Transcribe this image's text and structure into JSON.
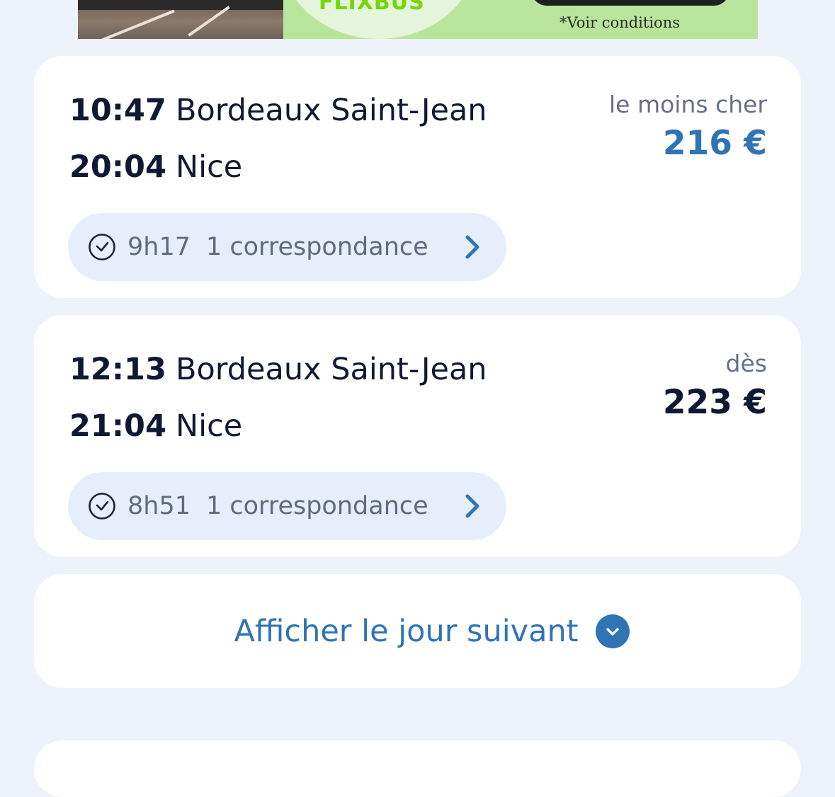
{
  "banner": {
    "brand": "FLIXBUS",
    "conditions": "*Voir conditions",
    "brand_color": "#73d700",
    "background_color": "#b8e59b"
  },
  "trips": [
    {
      "departure_time": "10:47",
      "departure_station": "Bordeaux Saint-Jean",
      "arrival_time": "20:04",
      "arrival_station": "Nice",
      "price_label": "le moins cher",
      "price": "216 €",
      "price_highlight": true,
      "duration": "9h17",
      "connections": "1 correspondance",
      "clock_icon": "clock-icon",
      "details_icon": "chevron-right-icon"
    },
    {
      "departure_time": "12:13",
      "departure_station": "Bordeaux Saint-Jean",
      "arrival_time": "21:04",
      "arrival_station": "Nice",
      "price_label": "dès",
      "price": "223 €",
      "price_highlight": false,
      "duration": "8h51",
      "connections": "1 correspondance",
      "clock_icon": "clock-icon",
      "details_icon": "chevron-right-icon"
    }
  ],
  "next_day": {
    "label": "Afficher le jour suivant",
    "icon": "chevron-down-circle-icon"
  },
  "colors": {
    "accent": "#2f74b5",
    "text_primary": "#0e1a33",
    "text_secondary": "#65708a",
    "pill_background": "#e6eefb",
    "page_background": "#eef2fa"
  }
}
